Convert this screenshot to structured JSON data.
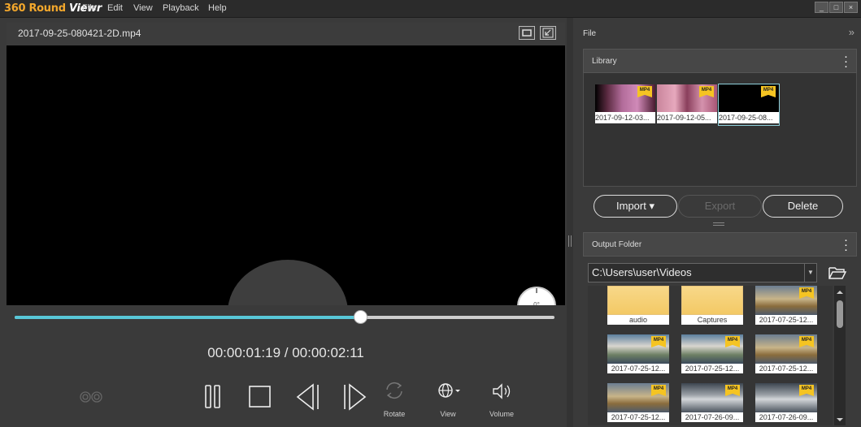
{
  "app": {
    "logo_main": "360 Round ",
    "logo_accent": "Viewr"
  },
  "menu": [
    "File",
    "Edit",
    "View",
    "Playback",
    "Help"
  ],
  "window_buttons": [
    "_",
    "□",
    "×"
  ],
  "video": {
    "filename": "2017-09-25-080421-2D.mp4",
    "compass_degrees": "0°"
  },
  "playback": {
    "progress_fraction": 0.64,
    "timecode": "00:00:01:19 / 00:00:02:11"
  },
  "controls": {
    "rotate_label": "Rotate",
    "view_label": "View",
    "volume_label": "Volume"
  },
  "right_panel": {
    "title": "File",
    "collapse_glyph": "»"
  },
  "library": {
    "header": "Library",
    "items": [
      {
        "caption": "2017-09-12-03...",
        "badge": "MP4"
      },
      {
        "caption": "2017-09-12-05...",
        "badge": "MP4"
      },
      {
        "caption": "2017-09-25-08...",
        "badge": "MP4"
      }
    ],
    "import_label": "Import",
    "export_label": "Export",
    "delete_label": "Delete"
  },
  "output": {
    "header": "Output Folder",
    "path": "C:\\Users\\user\\Videos",
    "items": [
      {
        "caption": "audio",
        "kind": "folder"
      },
      {
        "caption": "Captures",
        "kind": "folder"
      },
      {
        "caption": "2017-07-25-12...",
        "kind": "video",
        "badge": "MP4"
      },
      {
        "caption": "2017-07-25-12...",
        "kind": "video",
        "badge": "MP4"
      },
      {
        "caption": "2017-07-25-12...",
        "kind": "video",
        "badge": "MP4"
      },
      {
        "caption": "2017-07-25-12...",
        "kind": "video",
        "badge": "MP4"
      },
      {
        "caption": "2017-07-25-12...",
        "kind": "video",
        "badge": "MP4"
      },
      {
        "caption": "2017-07-26-09...",
        "kind": "video",
        "badge": "MP4"
      },
      {
        "caption": "2017-07-26-09...",
        "kind": "video",
        "badge": "MP4"
      }
    ]
  },
  "colors": {
    "accent": "#58c7d8",
    "logo": "#f4a82c",
    "badge": "#f5c422"
  }
}
